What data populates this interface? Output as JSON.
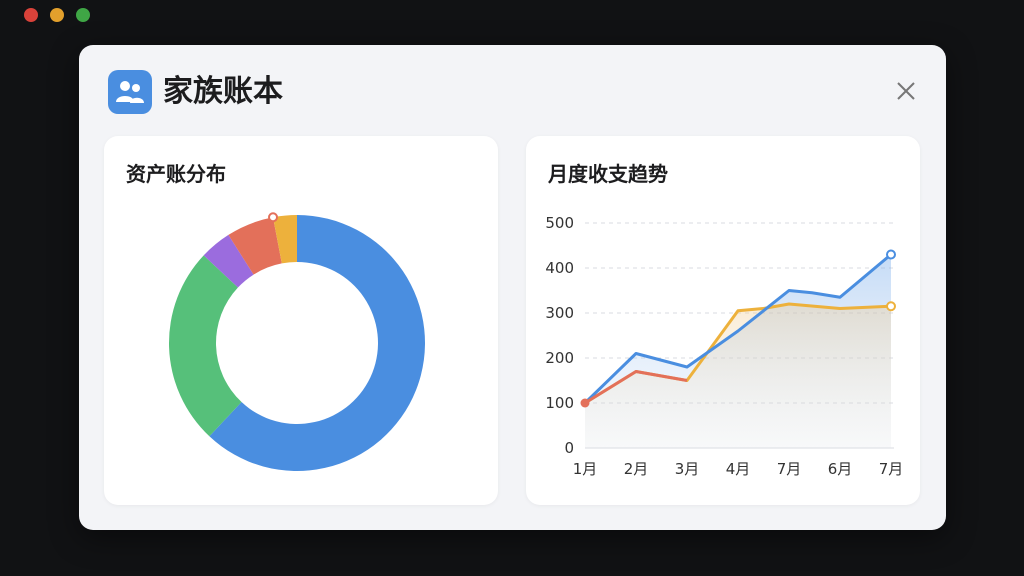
{
  "window": {
    "title": "家族账本",
    "app_icon": "family-icon",
    "close_icon": "close-icon"
  },
  "asset_card": {
    "title": "资产账分布"
  },
  "trend_card": {
    "title": "月度收支趋势"
  },
  "colors": {
    "blue": "#4a8ee0",
    "green": "#56c07a",
    "purple": "#9b6cde",
    "red": "#e3705a",
    "yellow": "#edb13c"
  },
  "chart_data": [
    {
      "type": "pie",
      "title": "资产账分布",
      "slices": [
        {
          "value": 62,
          "color": "#4a8ee0"
        },
        {
          "value": 25,
          "color": "#56c07a"
        },
        {
          "value": 4,
          "color": "#9b6cde"
        },
        {
          "value": 6,
          "color": "#e3705a"
        },
        {
          "value": 3,
          "color": "#edb13c"
        }
      ]
    },
    {
      "type": "line",
      "title": "月度收支趋势",
      "categories": [
        "1月",
        "2月",
        "3月",
        "4月",
        "7月",
        "6月",
        "7月"
      ],
      "ylim": [
        0,
        500
      ],
      "yticks": [
        "0",
        "100",
        "200",
        "300",
        "400",
        "500"
      ],
      "series": [
        {
          "color": "#4a8ee0",
          "x": [
            0,
            1,
            2,
            3,
            4,
            4.45,
            5,
            6
          ],
          "values": [
            100,
            210,
            180,
            260,
            350,
            345,
            335,
            430
          ]
        },
        {
          "color": "#edb13c",
          "x": [
            0,
            1,
            2,
            3,
            3.5,
            4,
            5,
            6
          ],
          "values": [
            100,
            170,
            150,
            305,
            310,
            320,
            310,
            315
          ]
        },
        {
          "color": "#e3705a",
          "x": [
            0,
            1,
            2
          ],
          "values": [
            100,
            170,
            150
          ]
        }
      ]
    }
  ]
}
